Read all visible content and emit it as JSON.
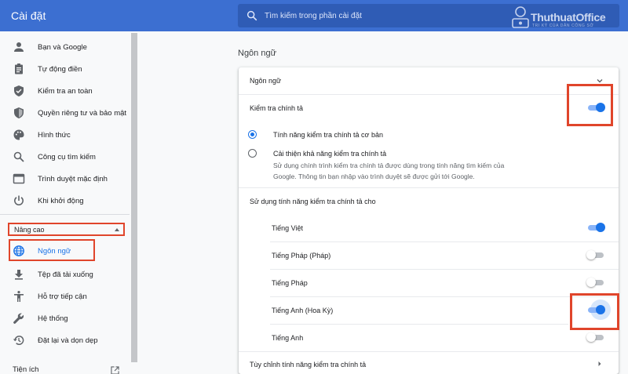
{
  "header": {
    "title": "Cài đặt",
    "search_placeholder": "Tìm kiếm trong phần cài đặt"
  },
  "watermark": {
    "text": "ThuthuatOffice",
    "subtext": "TRI KỶ CỦA DÂN CÔNG SỞ"
  },
  "sidebar": {
    "items": [
      {
        "label": "Bạn và Google",
        "icon": "person-icon"
      },
      {
        "label": "Tự động điền",
        "icon": "clipboard-icon"
      },
      {
        "label": "Kiểm tra an toàn",
        "icon": "shield-check-icon"
      },
      {
        "label": "Quyền riêng tư và bảo mật",
        "icon": "shield-lock-icon"
      },
      {
        "label": "Hình thức",
        "icon": "palette-icon"
      },
      {
        "label": "Công cụ tìm kiếm",
        "icon": "search-icon"
      },
      {
        "label": "Trình duyệt mặc định",
        "icon": "browser-icon"
      },
      {
        "label": "Khi khởi động",
        "icon": "power-icon"
      }
    ],
    "advanced_label": "Nâng cao",
    "advanced_items": [
      {
        "label": "Ngôn ngữ",
        "icon": "globe-icon",
        "active": true
      },
      {
        "label": "Tệp đã tải xuống",
        "icon": "download-icon"
      },
      {
        "label": "Hỗ trợ tiếp cận",
        "icon": "accessibility-icon"
      },
      {
        "label": "Hệ thống",
        "icon": "wrench-icon"
      },
      {
        "label": "Đặt lại và dọn dẹp",
        "icon": "restore-icon"
      }
    ],
    "extensions_label": "Tiện ích"
  },
  "main": {
    "section_title": "Ngôn ngữ",
    "languages_row": "Ngôn ngữ",
    "spellcheck_label": "Kiểm tra chính tả",
    "spellcheck_on": true,
    "basic_option": "Tính năng kiểm tra chính tả cơ bản",
    "enhanced_option": "Cải thiện khả năng kiểm tra chính tả",
    "enhanced_desc_1": "Sử dụng chính trình kiểm tra chính tả được dùng trong tính năng tìm kiếm của",
    "enhanced_desc_2": "Google. Thông tin bạn nhập vào trình duyệt sẽ được gửi tới Google.",
    "use_for_label": "Sử dụng tính năng kiểm tra chính tả cho",
    "languages": [
      {
        "name": "Tiếng Việt",
        "on": true
      },
      {
        "name": "Tiếng Pháp (Pháp)",
        "on": false
      },
      {
        "name": "Tiếng Pháp",
        "on": false
      },
      {
        "name": "Tiếng Anh (Hoa Kỳ)",
        "on": true
      },
      {
        "name": "Tiếng Anh",
        "on": false
      }
    ],
    "customize_label": "Tùy chỉnh tính năng kiểm tra chính tả"
  },
  "colors": {
    "header": "#3c6fd1",
    "accent": "#1a73e8",
    "highlight": "#e0452b"
  }
}
